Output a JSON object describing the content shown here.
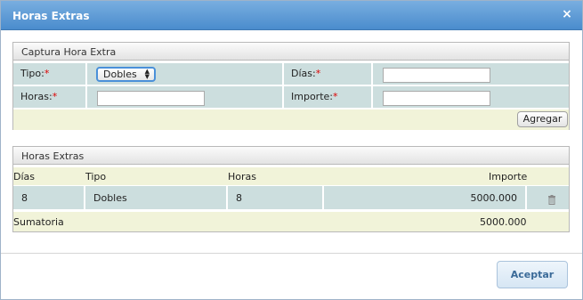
{
  "dialog": {
    "title": "Horas Extras",
    "close_glyph": "×",
    "close_icon": "close-icon"
  },
  "capture": {
    "title": "Captura Hora Extra",
    "tipo_label": "Tipo:",
    "tipo_value": "Dobles",
    "dias_label": "Días:",
    "horas_label": "Horas:",
    "importe_label": "Importe:",
    "required_mark": "*",
    "dias_value": "",
    "horas_value": "",
    "importe_value": "",
    "add_button": "Agregar"
  },
  "table": {
    "title": "Horas Extras",
    "columns": [
      "Días",
      "Tipo",
      "Horas",
      "Importe"
    ],
    "rows": [
      {
        "dias": "8",
        "tipo": "Dobles",
        "horas": "8",
        "importe": "5000.000"
      }
    ],
    "delete_icon": "trash-icon",
    "sum_label": "Sumatoria",
    "sum_value": "5000.000"
  },
  "footer": {
    "accept_button": "Aceptar"
  }
}
